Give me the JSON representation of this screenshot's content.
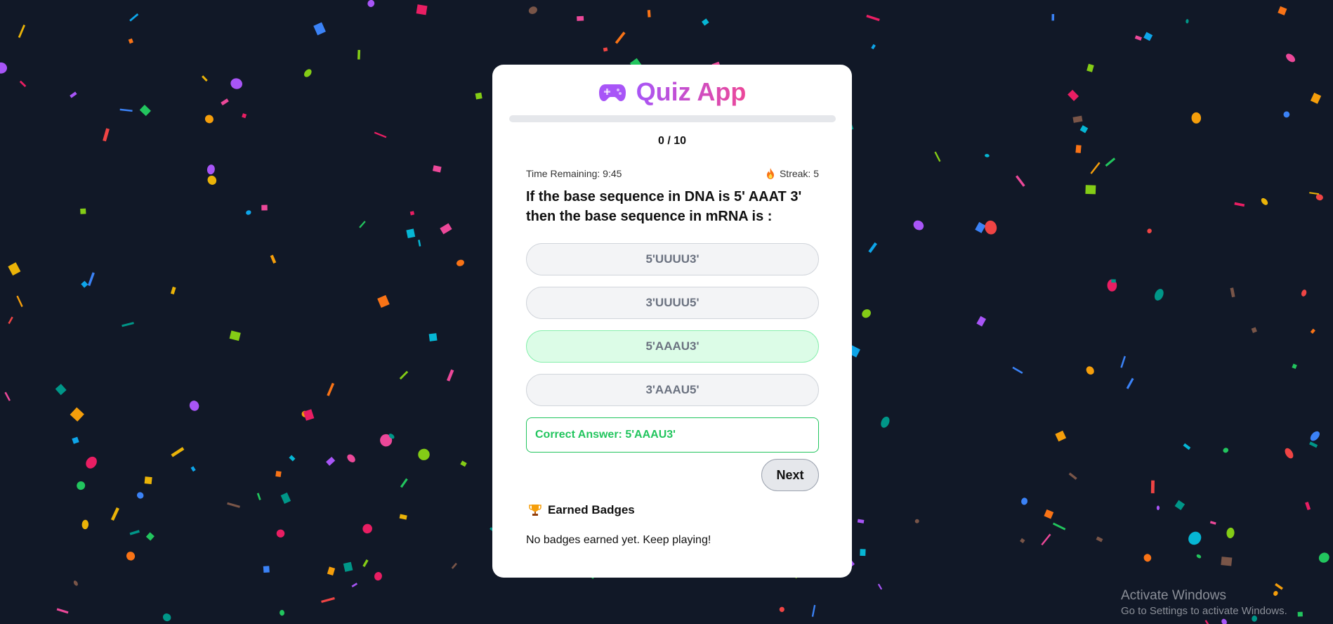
{
  "app": {
    "title": "Quiz App",
    "icon": "gamepad-icon",
    "accent_from": "#a855f7",
    "accent_to": "#ec4899"
  },
  "progress": {
    "counter": "0 / 10",
    "fraction": 0.0
  },
  "stats": {
    "time_remaining": "Time Remaining: 9:45",
    "streak_icon": "fire-icon",
    "streak": "Streak: 5"
  },
  "question": {
    "text": "If the base sequence in DNA is 5' AAAT 3' then the base sequence in mRNA is :"
  },
  "options": [
    {
      "label": "5'UUUU3'",
      "state": "neutral"
    },
    {
      "label": "3'UUUU5'",
      "state": "neutral"
    },
    {
      "label": "5'AAAU3'",
      "state": "correct"
    },
    {
      "label": "3'AAAU5'",
      "state": "neutral"
    }
  ],
  "feedback": {
    "text": "Correct Answer: 5'AAAU3'",
    "color": "#22c55e"
  },
  "next_button": {
    "label": "Next"
  },
  "badges": {
    "icon": "trophy-icon",
    "title": "Earned Badges",
    "empty_text": "No badges earned yet. Keep playing!"
  },
  "watermark": {
    "title": "Activate Windows",
    "subtitle": "Go to Settings to activate Windows."
  },
  "colors": {
    "background": "#111827",
    "card": "#ffffff",
    "correct_bg": "#dcfce7",
    "option_bg": "#f3f4f6"
  }
}
